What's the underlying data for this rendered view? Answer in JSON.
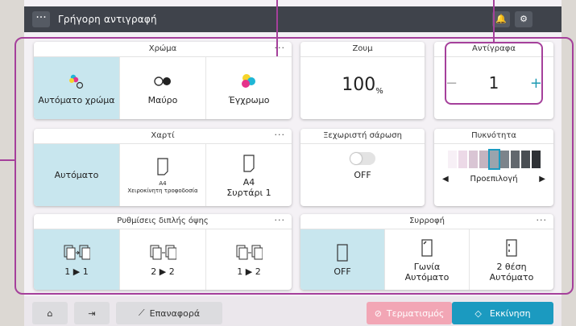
{
  "header": {
    "title": "Γρήγορη αντιγραφή",
    "menu_icon": "ellipsis-icon",
    "icons": [
      "bell-icon",
      "settings-refresh-icon"
    ]
  },
  "color_panel": {
    "title": "Χρώμα",
    "options": [
      {
        "label": "Αυτόματο χρώμα",
        "selected": true
      },
      {
        "label": "Μαύρο",
        "selected": false
      },
      {
        "label": "Έγχρωμο",
        "selected": false
      }
    ]
  },
  "zoom_panel": {
    "title": "Ζουμ",
    "value": "100",
    "unit": "%"
  },
  "copies_panel": {
    "title": "Αντίγραφα",
    "value": "1",
    "minus": "−",
    "plus": "+"
  },
  "paper_panel": {
    "title": "Χαρτί",
    "options": [
      {
        "label": "Αυτόματο",
        "selected": true
      },
      {
        "label_size": "A4",
        "label_source": "Χειροκίνητη τροφοδοσία"
      },
      {
        "label_size": "A4",
        "label_source": "Συρτάρι 1"
      }
    ]
  },
  "separate_scan": {
    "title": "Ξεχωριστή σάρωση",
    "value": "OFF"
  },
  "density_panel": {
    "title": "Πυκνότητα",
    "label": "Προεπιλογή",
    "level": 5,
    "levels": 9
  },
  "duplex_panel": {
    "title": "Ρυθμίσεις διπλής όψης",
    "options": [
      {
        "from": "1",
        "to": "1",
        "selected": true
      },
      {
        "from": "2",
        "to": "2"
      },
      {
        "from": "1",
        "to": "2"
      }
    ]
  },
  "combine_panel": {
    "title": "Συρροφή",
    "options": [
      {
        "label": "OFF",
        "selected": true
      },
      {
        "label": "Γωνία",
        "label2": "Αυτόματο"
      },
      {
        "label": "2 θέση",
        "label2": "Αυτόματο"
      }
    ]
  },
  "bottom_bar": {
    "home_icon": "home-icon",
    "exit_icon": "exit-icon",
    "reset_label": "Επαναφορά",
    "stop_label": "Τερματισμός",
    "start_label": "Εκκίνηση"
  },
  "colors": {
    "accent": "#1b9ac0",
    "selected": "#c8e6ee",
    "callout": "#a5409b",
    "stop": "#f2a6b5"
  }
}
